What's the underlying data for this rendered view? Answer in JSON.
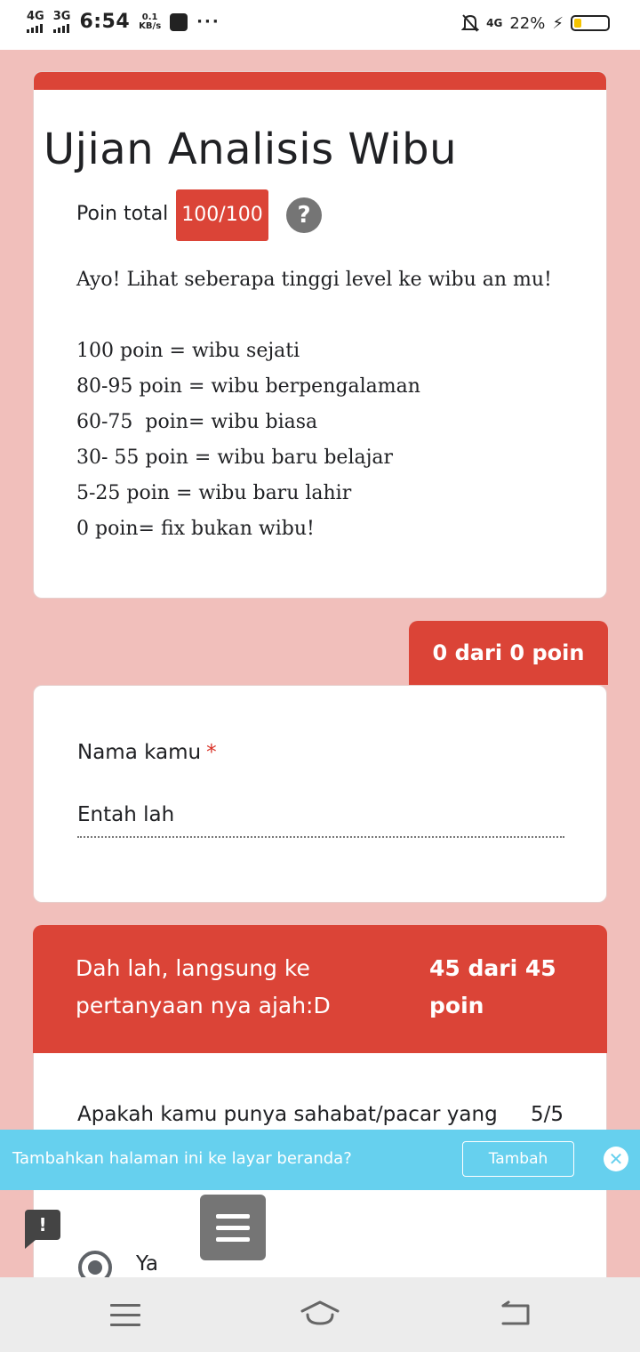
{
  "statusbar": {
    "net1": "4G",
    "net2": "3G",
    "time": "6:54",
    "speed_value": "0.1",
    "speed_unit": "KB/s",
    "dots": "···",
    "net3": "4G",
    "battery_percent": "22%",
    "battery_level": 0.22
  },
  "form": {
    "title": "Ujian Analisis Wibu",
    "points_label": "Poin total",
    "points_value": "100/100",
    "help_symbol": "?",
    "description": "Ayo! Lihat seberapa tinggi level ke wibu an mu!\n\n100 poin = wibu sejati\n80-95 poin = wibu berpengalaman\n60-75  poin= wibu biasa\n30- 55 poin = wibu baru belajar\n5-25 poin = wibu baru lahir\n0 poin= fix bukan wibu!"
  },
  "section1": {
    "score": "0 dari 0 poin",
    "question": "Nama kamu",
    "required_mark": "*",
    "answer": "Entah lah"
  },
  "section2": {
    "title": "Dah lah, langsung ke pertanyaan nya ajah:D",
    "score": "45 dari 45 poin",
    "question": "Apakah kamu punya sahabat/pacar yang",
    "question_score": "5/5",
    "option_selected": "Ya"
  },
  "banner": {
    "message": "Tambahkan halaman ini ke layar beranda?",
    "button": "Tambah",
    "close_symbol": "✕"
  },
  "feedback_symbol": "!",
  "colors": {
    "accent": "#db4437",
    "page_bg": "#f1bfbb",
    "banner_bg": "#66d0ee"
  }
}
